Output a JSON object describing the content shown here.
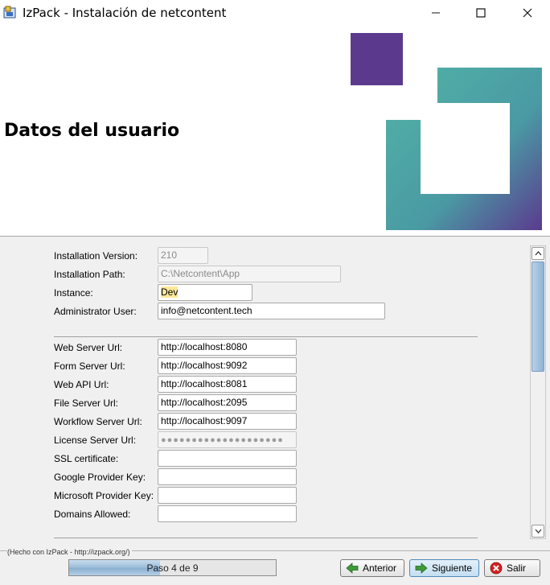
{
  "window": {
    "title": "IzPack - Instalación de  netcontent",
    "controls": {
      "minimize": "—",
      "maximize": "☐",
      "close": "✕"
    }
  },
  "header": {
    "title": "Datos del usuario"
  },
  "form": {
    "installation_version": {
      "label": "Installation Version:",
      "value": "210"
    },
    "installation_path": {
      "label": "Installation Path:",
      "value": "C:\\Netcontent\\App"
    },
    "instance": {
      "label": "Instance:",
      "value": "Dev"
    },
    "admin_user": {
      "label": "Administrator User:",
      "value": "info@netcontent.tech"
    },
    "web_server_url": {
      "label": "Web Server Url:",
      "value": "http://localhost:8080"
    },
    "form_server_url": {
      "label": "Form Server Url:",
      "value": "http://localhost:9092"
    },
    "web_api_url": {
      "label": "Web API Url:",
      "value": "http://localhost:8081"
    },
    "file_server_url": {
      "label": "File Server Url:",
      "value": "http://localhost:2095"
    },
    "workflow_server_url": {
      "label": "Workflow Server Url:",
      "value": "http://localhost:9097"
    },
    "license_server_url": {
      "label": "License Server Url:",
      "value": "●●●●●●●●●●●●●●●●●●●●"
    },
    "ssl_certificate": {
      "label": "SSL certificate:",
      "value": ""
    },
    "google_provider_key": {
      "label": "Google Provider Key:",
      "value": ""
    },
    "microsoft_provider_key": {
      "label": "Microsoft Provider Key:",
      "value": ""
    },
    "domains_allowed": {
      "label": "Domains Allowed:",
      "value": ""
    }
  },
  "footer": {
    "credit": "(Hecho con IzPack - http://izpack.org/)",
    "progress": {
      "text": "Paso 4 de 9",
      "fraction": 0.44
    },
    "buttons": {
      "previous": "Anterior",
      "next": "Siguiente",
      "exit": "Salir"
    }
  },
  "colors": {
    "logo_purple": "#5b3a8e",
    "logo_teal": "#4fb3a4",
    "accent_blue": "#4f8ab8"
  }
}
